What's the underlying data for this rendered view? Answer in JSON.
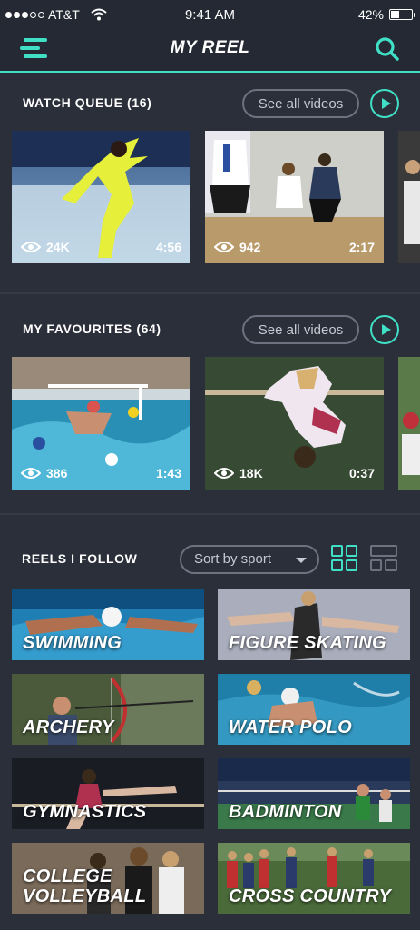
{
  "status_bar": {
    "carrier": "AT&T",
    "time": "9:41 AM",
    "battery_percent": "42%",
    "battery_level": 0.42
  },
  "header": {
    "title": "MY REEL",
    "menu_icon": "hamburger-menu-icon",
    "search_icon": "search-icon"
  },
  "accent_color": "#3fe0c6",
  "watch_queue": {
    "title": "WATCH QUEUE (16)",
    "see_all_label": "See all videos",
    "videos": [
      {
        "views": "24K",
        "duration": "4:56",
        "sport": "figure skating"
      },
      {
        "views": "942",
        "duration": "2:17",
        "sport": "volleyball"
      }
    ]
  },
  "favourites": {
    "title": "MY FAVOURITES (64)",
    "see_all_label": "See all videos",
    "videos": [
      {
        "views": "386",
        "duration": "1:43",
        "sport": "water polo"
      },
      {
        "views": "18K",
        "duration": "0:37",
        "sport": "gymnastics"
      }
    ]
  },
  "reels_follow": {
    "title": "REELS I FOLLOW",
    "sort_label": "Sort by sport",
    "view_modes": [
      "grid-view-icon",
      "list-view-icon"
    ],
    "active_view": "grid",
    "reels": [
      {
        "label": "SWIMMING"
      },
      {
        "label": "FIGURE SKATING"
      },
      {
        "label": "ARCHERY"
      },
      {
        "label": "WATER POLO"
      },
      {
        "label": "GYMNASTICS"
      },
      {
        "label": "BADMINTON"
      },
      {
        "label": "COLLEGE VOLLEYBALL"
      },
      {
        "label": "CROSS COUNTRY"
      }
    ]
  }
}
